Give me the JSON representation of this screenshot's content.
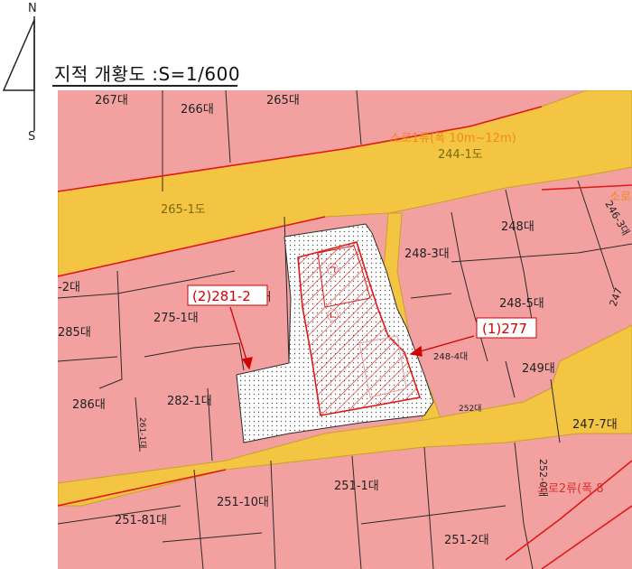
{
  "title": "지적 개황도 :S=1/600",
  "compass": {
    "north": "N",
    "south": "S"
  },
  "colors": {
    "parcel_fill": "#f2a0a0",
    "parcel_line": "#2b2b2b",
    "road_fill": "#f4c542",
    "road_edge": "#c9a12a",
    "boundary_red": "#e01818",
    "site_fill": "#ffffff",
    "annotation_red": "#d40000",
    "road_label_orange": "#f08a1c",
    "road_label_red": "#e03030"
  },
  "parcels": [
    "267대",
    "266대",
    "265대",
    "265-1도",
    "244-1도",
    "248대",
    "248-3대",
    "248-5대",
    "246-3대",
    "247",
    "275-1대",
    "285대",
    "286대",
    "282-1대",
    "2대",
    "-2대",
    "249대",
    "248-4대",
    "247-7대",
    "251-1대",
    "251-10대",
    "251-81대",
    "251-2대",
    "252대",
    "252-0대",
    "261-1대"
  ],
  "road_labels": {
    "upper": "소로1류(폭 10m~12m)",
    "lower": "소로2류(폭 8",
    "right_edge": "소로"
  },
  "callouts": [
    {
      "label": "(1)277"
    },
    {
      "label": "(2)281-2"
    }
  ],
  "site_marks": [
    "㉠",
    "㉡"
  ]
}
